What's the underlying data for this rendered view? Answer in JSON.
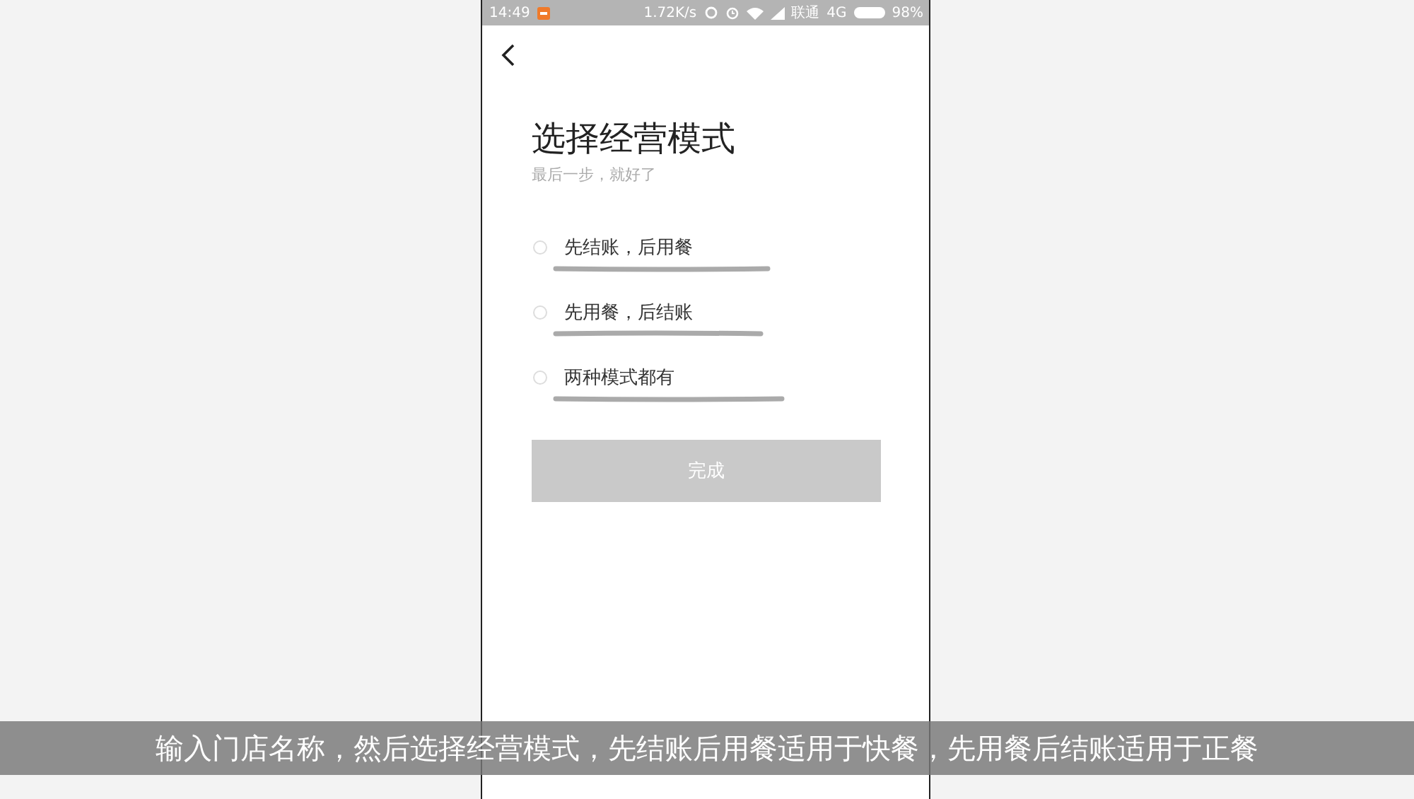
{
  "status_bar": {
    "time": "14:49",
    "speed": "1.72K/s",
    "carrier": "联通",
    "network": "4G",
    "battery": "98%"
  },
  "title": "选择经营模式",
  "subtitle": "最后一步，就好了",
  "options": [
    {
      "label": "先结账，后用餐",
      "selected": false
    },
    {
      "label": "先用餐，后结账",
      "selected": false
    },
    {
      "label": "两种模式都有",
      "selected": false
    }
  ],
  "done_button": {
    "label": "完成",
    "disabled": true
  },
  "caption": "输入门店名称，然后选择经营模式，先结账后用餐适用于快餐，先用餐后结账适用于正餐"
}
